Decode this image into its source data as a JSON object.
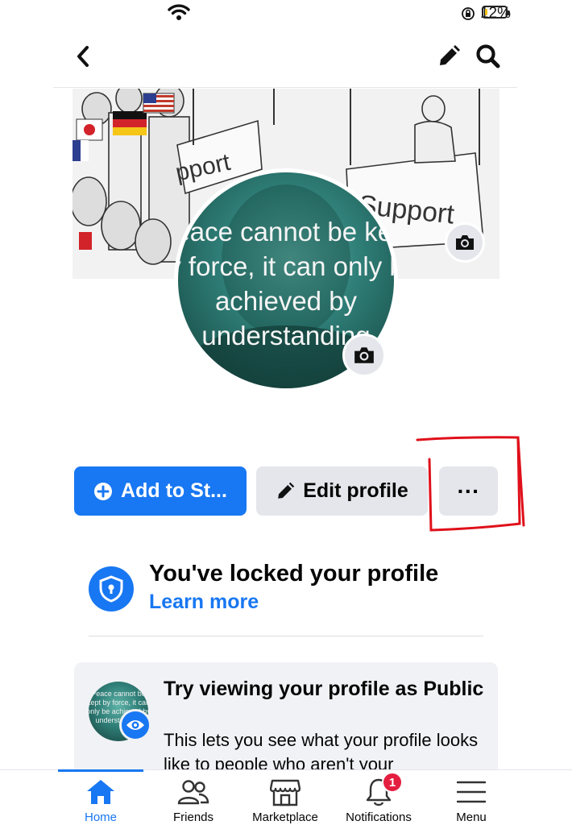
{
  "status_bar": {
    "battery_percent": "12%",
    "battery_level": 0.12
  },
  "header": {
    "back_icon": "chevron-left-icon",
    "edit_icon": "pencil-icon",
    "search_icon": "search-icon"
  },
  "cover": {
    "camera_icon": "camera-icon",
    "sign_left": "pport",
    "sign_right": "Support"
  },
  "profile_picture": {
    "quote": "Peace cannot be kept by force, it can only be achieved by understanding",
    "camera_icon": "camera-icon"
  },
  "actions": {
    "add_story_label": "Add to St...",
    "edit_profile_label": "Edit profile",
    "more_label": "···"
  },
  "locked": {
    "title": "You've locked your profile",
    "link": "Learn more",
    "icon": "shield-lock-icon"
  },
  "public_view": {
    "title": "Try viewing your profile as Public",
    "description": "This lets you see what your profile looks like to people who aren't your",
    "mini_quote": "Peace cannot be kept by force, it can only be achieved by understanding",
    "icon": "eye-icon"
  },
  "tabbar": {
    "items": [
      {
        "label": "Home",
        "icon": "home-icon",
        "active": true
      },
      {
        "label": "Friends",
        "icon": "friends-icon",
        "active": false
      },
      {
        "label": "Marketplace",
        "icon": "marketplace-icon",
        "active": false
      },
      {
        "label": "Notifications",
        "icon": "bell-icon",
        "active": false,
        "badge": "1"
      },
      {
        "label": "Menu",
        "icon": "menu-icon",
        "active": false
      }
    ]
  },
  "colors": {
    "accent": "#1877f2",
    "button_gray": "#e4e6eb",
    "badge_red": "#e41e3f",
    "annotation_red": "#e0101a"
  }
}
